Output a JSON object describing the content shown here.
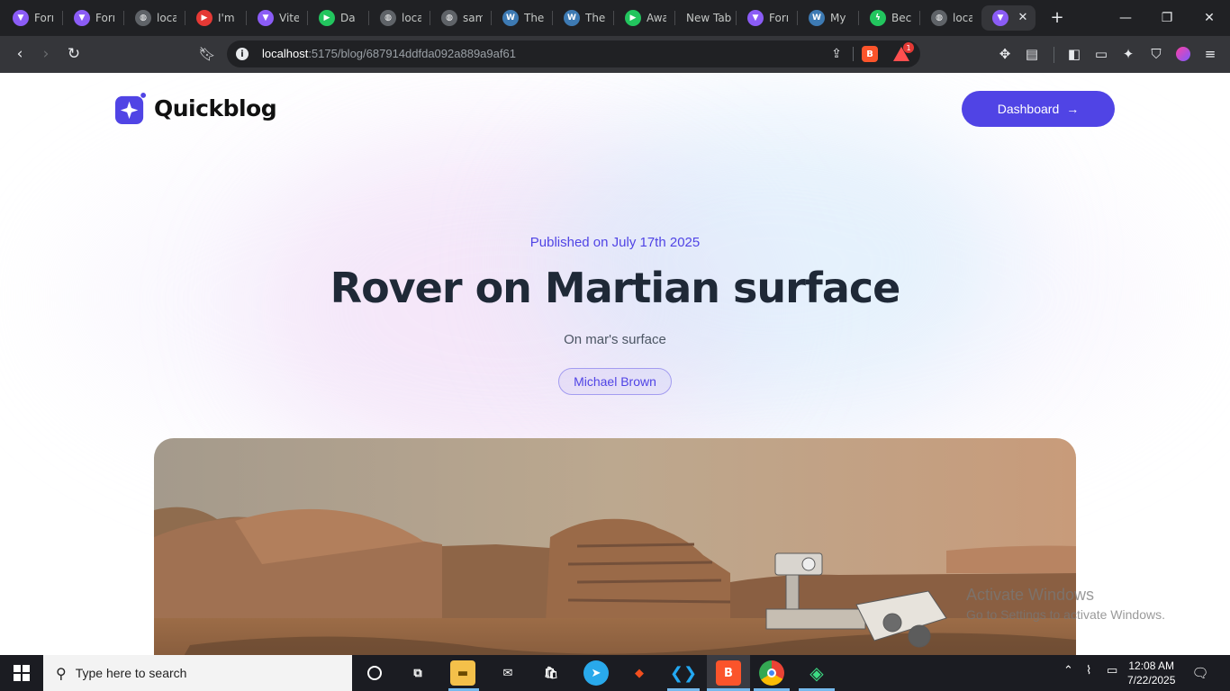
{
  "browser": {
    "tabs": [
      {
        "label": "Forı",
        "favicon": "vite-icon",
        "color": "#8b5cf6"
      },
      {
        "label": "Forı",
        "favicon": "vite-icon",
        "color": "#8b5cf6"
      },
      {
        "label": "loca",
        "favicon": "globe-icon",
        "color": "#5f6368"
      },
      {
        "label": "I'm",
        "favicon": "youtube-icon",
        "color": "#e53935"
      },
      {
        "label": "Vite",
        "favicon": "vite-icon",
        "color": "#8b5cf6"
      },
      {
        "label": "Da",
        "favicon": "play-icon",
        "color": "#22c55e"
      },
      {
        "label": "loca",
        "favicon": "globe-icon",
        "color": "#5f6368"
      },
      {
        "label": "sam",
        "favicon": "globe-icon",
        "color": "#5f6368"
      },
      {
        "label": "The",
        "favicon": "wordpress-icon",
        "color": "#3d7ab3"
      },
      {
        "label": "The",
        "favicon": "wordpress-icon",
        "color": "#3d7ab3"
      },
      {
        "label": "Awa",
        "favicon": "play-icon",
        "color": "#22c55e"
      },
      {
        "label": "New Tab",
        "favicon": "",
        "color": ""
      },
      {
        "label": "Forı",
        "favicon": "vite-icon",
        "color": "#8b5cf6"
      },
      {
        "label": "My",
        "favicon": "wordpress-icon",
        "color": "#3d7ab3"
      },
      {
        "label": "Bec",
        "favicon": "bolt-icon",
        "color": "#22c55e"
      },
      {
        "label": "loca",
        "favicon": "globe-icon",
        "color": "#5f6368"
      }
    ],
    "url_host": "localhost",
    "url_path": ":5175/blog/687914ddfda092a889a9af61",
    "rewards_badge": "1"
  },
  "site": {
    "logo_text": "Quickblog",
    "dashboard_label": "Dashboard",
    "accent": "#5044e5"
  },
  "post": {
    "published": "Published on July 17th 2025",
    "title": "Rover on Martian surface",
    "subtitle": "On mar's surface",
    "author": "Michael Brown"
  },
  "watermark": {
    "line1": "Activate Windows",
    "line2": "Go to Settings to activate Windows."
  },
  "taskbar": {
    "search_placeholder": "Type here to search",
    "time": "12:08 AM",
    "date": "7/22/2025"
  }
}
